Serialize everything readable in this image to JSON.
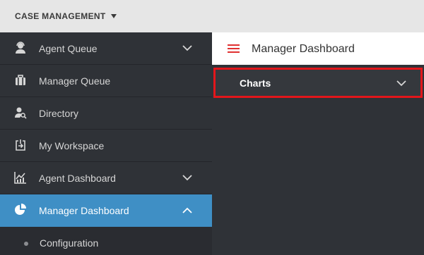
{
  "header": {
    "app_title": "CASE MANAGEMENT",
    "dropdown_icon": "caret-down-icon"
  },
  "sidebar": {
    "items": [
      {
        "label": "Agent Queue",
        "icon": "agent-icon",
        "expandable": true,
        "expanded": false
      },
      {
        "label": "Manager Queue",
        "icon": "briefcase-icon",
        "expandable": false
      },
      {
        "label": "Directory",
        "icon": "person-search-icon",
        "expandable": false
      },
      {
        "label": "My Workspace",
        "icon": "workspace-icon",
        "expandable": false
      },
      {
        "label": "Agent Dashboard",
        "icon": "line-chart-icon",
        "expandable": true,
        "expanded": false
      },
      {
        "label": "Manager Dashboard",
        "icon": "pie-chart-icon",
        "expandable": true,
        "expanded": true,
        "active": true
      }
    ],
    "subitems": [
      {
        "label": "Configuration"
      }
    ]
  },
  "main": {
    "title": "Manager Dashboard",
    "menu_icon": "hamburger-icon",
    "panels": [
      {
        "label": "Charts",
        "collapsed": true,
        "highlighted": true
      }
    ]
  },
  "colors": {
    "topbar": "#e6e6e6",
    "sidebar": "#2f3237",
    "active": "#3f8fc5",
    "accent": "#e03131",
    "highlight_border": "#e3161b"
  }
}
